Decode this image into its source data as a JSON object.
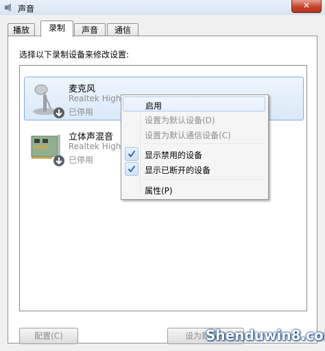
{
  "window": {
    "title": "声音",
    "close_label": "✕"
  },
  "tabs": [
    {
      "label": "播放",
      "active": false
    },
    {
      "label": "录制",
      "active": true
    },
    {
      "label": "声音",
      "active": false
    },
    {
      "label": "通信",
      "active": false
    }
  ],
  "instruction": "选择以下录制设备来修改设置:",
  "devices": [
    {
      "name": "麦克风",
      "description": "Realtek High Definition Audio",
      "status": "已停用",
      "icon": "microphone-icon",
      "selected": true
    },
    {
      "name": "立体声混音",
      "description": "Realtek High D",
      "status": "已停用",
      "icon": "sound-card-icon",
      "selected": false
    }
  ],
  "context_menu": {
    "items": [
      {
        "label": "启用",
        "enabled": true,
        "checked": false,
        "hover": true
      },
      {
        "label": "设置为默认设备(D)",
        "enabled": false,
        "checked": false
      },
      {
        "label": "设置为默认通信设备(C)",
        "enabled": false,
        "checked": false
      },
      {
        "label": "显示禁用的设备",
        "enabled": true,
        "checked": true
      },
      {
        "label": "显示已断开的设备",
        "enabled": true,
        "checked": true
      },
      {
        "label": "属性(P)",
        "enabled": true,
        "checked": false
      }
    ]
  },
  "buttons": {
    "configure": "配置(C)",
    "set_default": "设为默认值"
  },
  "watermark": "Shenduwin8.com",
  "colors": {
    "selection_border": "#84acdd",
    "disabled_text": "#8c8c8c",
    "check_mark": "#1e5bb8",
    "close_button": "#c7442c"
  }
}
